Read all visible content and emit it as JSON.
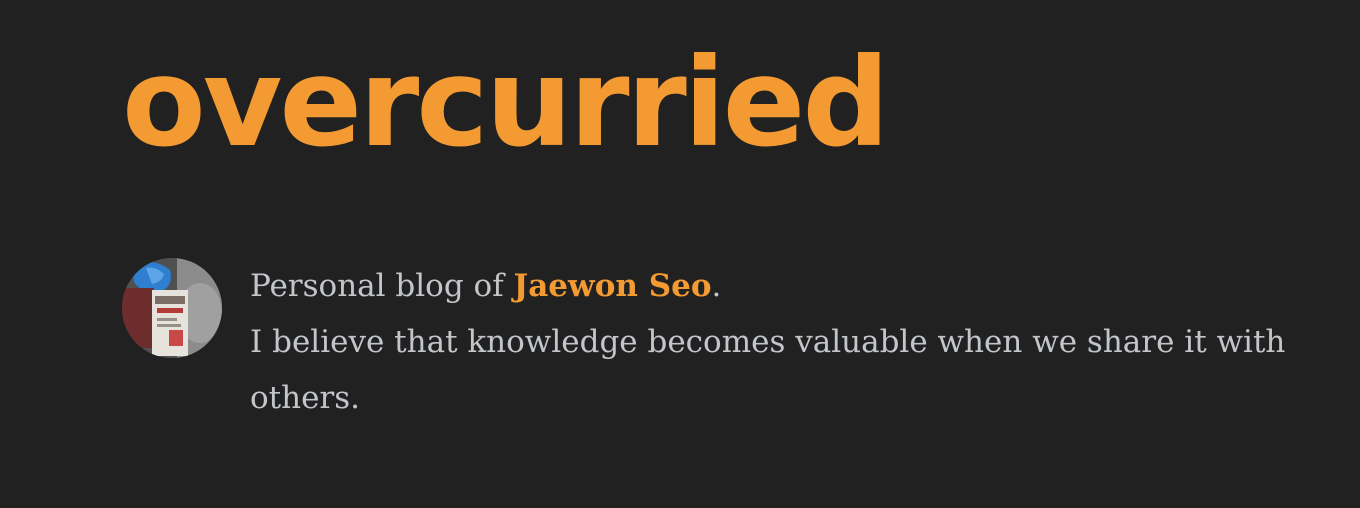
{
  "header": {
    "site_title": "overcurried"
  },
  "bio": {
    "avatar_icon": "profile-photo",
    "intro_prefix": "Personal blog of ",
    "author_name": "Jaewon Seo",
    "intro_suffix": ".",
    "tagline": "I believe that knowledge becomes valuable when we share it with others."
  },
  "colors": {
    "background": "#212121",
    "accent": "#f39b32",
    "body_text": "#c2c5c9"
  }
}
